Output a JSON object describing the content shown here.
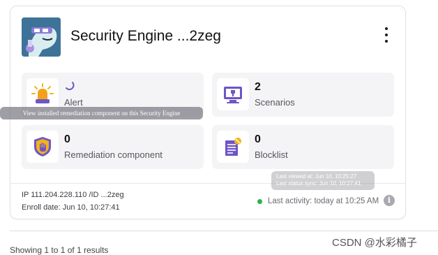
{
  "engine": {
    "title": "Security Engine ...2zeg",
    "ip_line": "IP 111.204.228.110 /ID ...2zeg",
    "enroll_line": "Enroll date: Jun 10, 10:27:41",
    "last_activity": "Last activity: today at 10:25 AM",
    "status_color": "#2bb24c"
  },
  "tiles": [
    {
      "value": "",
      "label": "Alert",
      "icon": "alarm-siren-icon"
    },
    {
      "value": "2",
      "label": "Scenarios",
      "icon": "scenario-monitor-icon"
    },
    {
      "value": "0",
      "label": "Remediation component",
      "icon": "shield-hand-icon"
    },
    {
      "value": "0",
      "label": "Blocklist",
      "icon": "blocklist-document-icon"
    }
  ],
  "tooltips": {
    "remediation_hint": "View installed remediation component on this Security Engine",
    "last_viewed": "Last viewed at: Jun 10, 10:25:27",
    "last_status_sync": "Last status sync: Jun 10, 10:27:41"
  },
  "pagination": {
    "showing": "Showing 1 to 1 of 1 results"
  },
  "watermark": "CSDN @水彩橘子",
  "colors": {
    "accent_purple": "#6d56c6",
    "tile_bg": "#f4f4f6"
  }
}
